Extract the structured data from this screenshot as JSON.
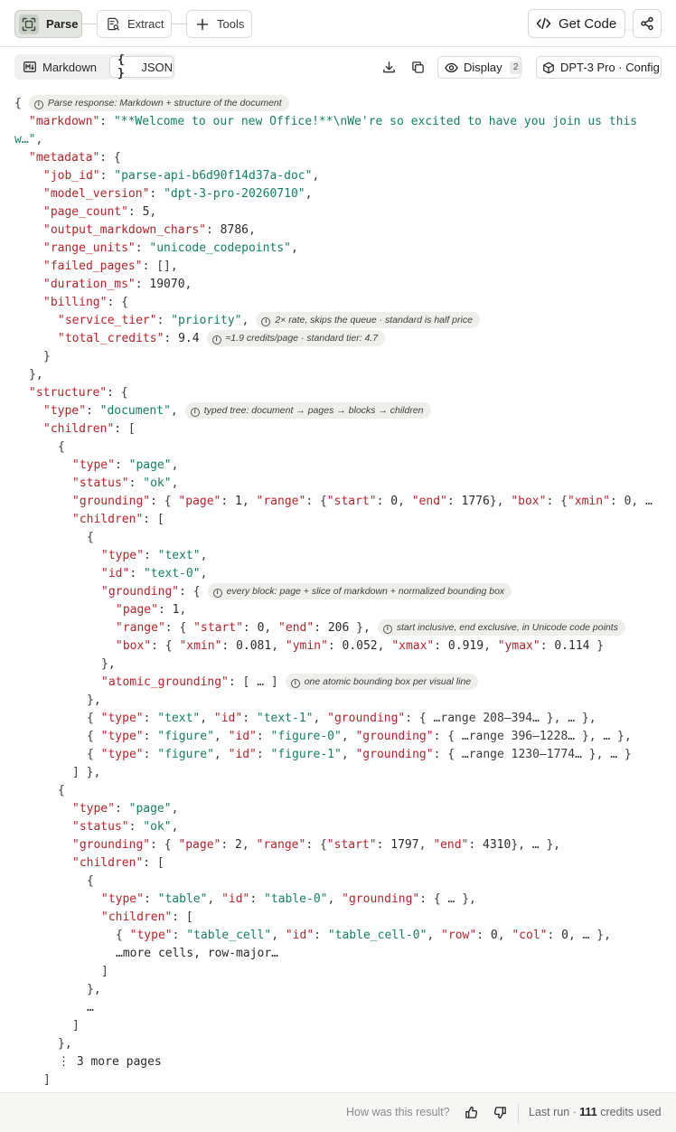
{
  "top_tabs": {
    "parse": "Parse",
    "extract": "Extract",
    "tools": "Tools"
  },
  "actions": {
    "get_code": "Get Code"
  },
  "format_tabs": {
    "markdown": "Markdown",
    "json": "JSON"
  },
  "display": {
    "label": "Display",
    "count": "2"
  },
  "config": {
    "label": "DPT-3 Pro · Config"
  },
  "json_view": {
    "lines": [
      {
        "indent": 0,
        "parts": [
          [
            "p",
            "{"
          ]
        ],
        "note": "Parse response: Markdown + structure of the document"
      },
      {
        "indent": 1,
        "parts": [
          [
            "k",
            "\"markdown\""
          ],
          [
            "p",
            ": "
          ],
          [
            "s",
            "\"**Welcome to our new Office!**\\nWe're so excited to have you join us this"
          ]
        ]
      },
      {
        "indent": 0,
        "parts": [
          [
            "s",
            "w…\""
          ],
          [
            "p",
            ","
          ]
        ]
      },
      {
        "indent": 1,
        "parts": [
          [
            "k",
            "\"metadata\""
          ],
          [
            "p",
            ": {"
          ]
        ]
      },
      {
        "indent": 2,
        "parts": [
          [
            "k",
            "\"job_id\""
          ],
          [
            "p",
            ": "
          ],
          [
            "s",
            "\"parse-api-b6d90f14d37a-doc\""
          ],
          [
            "p",
            ","
          ]
        ]
      },
      {
        "indent": 2,
        "parts": [
          [
            "k",
            "\"model_version\""
          ],
          [
            "p",
            ": "
          ],
          [
            "s",
            "\"dpt-3-pro-20260710\""
          ],
          [
            "p",
            ","
          ]
        ]
      },
      {
        "indent": 2,
        "parts": [
          [
            "k",
            "\"page_count\""
          ],
          [
            "p",
            ": "
          ],
          [
            "n",
            "5"
          ],
          [
            "p",
            ","
          ]
        ]
      },
      {
        "indent": 2,
        "parts": [
          [
            "k",
            "\"output_markdown_chars\""
          ],
          [
            "p",
            ": "
          ],
          [
            "n",
            "8786"
          ],
          [
            "p",
            ","
          ]
        ]
      },
      {
        "indent": 2,
        "parts": [
          [
            "k",
            "\"range_units\""
          ],
          [
            "p",
            ": "
          ],
          [
            "s",
            "\"unicode_codepoints\""
          ],
          [
            "p",
            ","
          ]
        ]
      },
      {
        "indent": 2,
        "parts": [
          [
            "k",
            "\"failed_pages\""
          ],
          [
            "p",
            ": [],"
          ]
        ]
      },
      {
        "indent": 2,
        "parts": [
          [
            "k",
            "\"duration_ms\""
          ],
          [
            "p",
            ": "
          ],
          [
            "n",
            "19070"
          ],
          [
            "p",
            ","
          ]
        ]
      },
      {
        "indent": 2,
        "parts": [
          [
            "k",
            "\"billing\""
          ],
          [
            "p",
            ": {"
          ]
        ]
      },
      {
        "indent": 3,
        "parts": [
          [
            "k",
            "\"service_tier\""
          ],
          [
            "p",
            ": "
          ],
          [
            "s",
            "\"priority\""
          ],
          [
            "p",
            ","
          ]
        ],
        "note": "2× rate, skips the queue · standard is half price"
      },
      {
        "indent": 3,
        "parts": [
          [
            "k",
            "\"total_credits\""
          ],
          [
            "p",
            ": "
          ],
          [
            "n",
            "9.4"
          ]
        ],
        "note": "≈1.9 credits/page · standard tier: 4.7"
      },
      {
        "indent": 2,
        "parts": [
          [
            "p",
            "}"
          ]
        ]
      },
      {
        "indent": 1,
        "parts": [
          [
            "p",
            "},"
          ]
        ]
      },
      {
        "indent": 1,
        "parts": [
          [
            "k",
            "\"structure\""
          ],
          [
            "p",
            ": {"
          ]
        ]
      },
      {
        "indent": 2,
        "parts": [
          [
            "k",
            "\"type\""
          ],
          [
            "p",
            ": "
          ],
          [
            "s",
            "\"document\""
          ],
          [
            "p",
            ","
          ]
        ],
        "note": "typed tree: document → pages → blocks → children"
      },
      {
        "indent": 2,
        "parts": [
          [
            "k",
            "\"children\""
          ],
          [
            "p",
            ": ["
          ]
        ]
      },
      {
        "indent": 3,
        "parts": [
          [
            "p",
            "{"
          ]
        ]
      },
      {
        "indent": 4,
        "parts": [
          [
            "k",
            "\"type\""
          ],
          [
            "p",
            ": "
          ],
          [
            "s",
            "\"page\""
          ],
          [
            "p",
            ","
          ]
        ]
      },
      {
        "indent": 4,
        "parts": [
          [
            "k",
            "\"status\""
          ],
          [
            "p",
            ": "
          ],
          [
            "s",
            "\"ok\""
          ],
          [
            "p",
            ","
          ]
        ]
      },
      {
        "indent": 4,
        "parts": [
          [
            "k",
            "\"grounding\""
          ],
          [
            "p",
            ": { "
          ],
          [
            "k",
            "\"page\""
          ],
          [
            "p",
            ": "
          ],
          [
            "n",
            "1"
          ],
          [
            "p",
            ", "
          ],
          [
            "k",
            "\"range\""
          ],
          [
            "p",
            ": {"
          ],
          [
            "k",
            "\"start\""
          ],
          [
            "p",
            ": "
          ],
          [
            "n",
            "0"
          ],
          [
            "p",
            ", "
          ],
          [
            "k",
            "\"end\""
          ],
          [
            "p",
            ": "
          ],
          [
            "n",
            "1776"
          ],
          [
            "p",
            "}, "
          ],
          [
            "k",
            "\"box\""
          ],
          [
            "p",
            ": {"
          ],
          [
            "k",
            "\"xmin\""
          ],
          [
            "p",
            ": 0, …"
          ]
        ]
      },
      {
        "indent": 4,
        "parts": [
          [
            "k",
            "\"children\""
          ],
          [
            "p",
            ": ["
          ]
        ]
      },
      {
        "indent": 5,
        "parts": [
          [
            "p",
            "{"
          ]
        ]
      },
      {
        "indent": 6,
        "parts": [
          [
            "k",
            "\"type\""
          ],
          [
            "p",
            ": "
          ],
          [
            "s",
            "\"text\""
          ],
          [
            "p",
            ","
          ]
        ]
      },
      {
        "indent": 6,
        "parts": [
          [
            "k",
            "\"id\""
          ],
          [
            "p",
            ": "
          ],
          [
            "s",
            "\"text-0\""
          ],
          [
            "p",
            ","
          ]
        ]
      },
      {
        "indent": 6,
        "parts": [
          [
            "k",
            "\"grounding\""
          ],
          [
            "p",
            ": {"
          ]
        ],
        "note": "every block: page + slice of markdown + normalized bounding box"
      },
      {
        "indent": 7,
        "parts": [
          [
            "k",
            "\"page\""
          ],
          [
            "p",
            ": "
          ],
          [
            "n",
            "1"
          ],
          [
            "p",
            ","
          ]
        ]
      },
      {
        "indent": 7,
        "parts": [
          [
            "k",
            "\"range\""
          ],
          [
            "p",
            ": { "
          ],
          [
            "k",
            "\"start\""
          ],
          [
            "p",
            ": "
          ],
          [
            "n",
            "0"
          ],
          [
            "p",
            ", "
          ],
          [
            "k",
            "\"end\""
          ],
          [
            "p",
            ": "
          ],
          [
            "n",
            "206"
          ],
          [
            "p",
            " },"
          ]
        ],
        "note": "start inclusive, end exclusive, in Unicode code points"
      },
      {
        "indent": 7,
        "parts": [
          [
            "k",
            "\"box\""
          ],
          [
            "p",
            ": { "
          ],
          [
            "k",
            "\"xmin\""
          ],
          [
            "p",
            ": "
          ],
          [
            "n",
            "0.081"
          ],
          [
            "p",
            ", "
          ],
          [
            "k",
            "\"ymin\""
          ],
          [
            "p",
            ": "
          ],
          [
            "n",
            "0.052"
          ],
          [
            "p",
            ", "
          ],
          [
            "k",
            "\"xmax\""
          ],
          [
            "p",
            ": "
          ],
          [
            "n",
            "0.919"
          ],
          [
            "p",
            ", "
          ],
          [
            "k",
            "\"ymax\""
          ],
          [
            "p",
            ": "
          ],
          [
            "n",
            "0.114"
          ],
          [
            "p",
            " }"
          ]
        ]
      },
      {
        "indent": 6,
        "parts": [
          [
            "p",
            "},"
          ]
        ]
      },
      {
        "indent": 6,
        "parts": [
          [
            "k",
            "\"atomic_grounding\""
          ],
          [
            "p",
            ": [ … ]"
          ]
        ],
        "note": "one atomic bounding box per visual line"
      },
      {
        "indent": 5,
        "parts": [
          [
            "p",
            "},"
          ]
        ]
      },
      {
        "indent": 5,
        "parts": [
          [
            "p",
            "{ "
          ],
          [
            "k",
            "\"type\""
          ],
          [
            "p",
            ": "
          ],
          [
            "s",
            "\"text\""
          ],
          [
            "p",
            ", "
          ],
          [
            "k",
            "\"id\""
          ],
          [
            "p",
            ": "
          ],
          [
            "s",
            "\"text-1\""
          ],
          [
            "p",
            ", "
          ],
          [
            "k",
            "\"grounding\""
          ],
          [
            "p",
            ": { …range 208–394… }, … },"
          ]
        ]
      },
      {
        "indent": 5,
        "parts": [
          [
            "p",
            "{ "
          ],
          [
            "k",
            "\"type\""
          ],
          [
            "p",
            ": "
          ],
          [
            "s",
            "\"figure\""
          ],
          [
            "p",
            ", "
          ],
          [
            "k",
            "\"id\""
          ],
          [
            "p",
            ": "
          ],
          [
            "s",
            "\"figure-0\""
          ],
          [
            "p",
            ", "
          ],
          [
            "k",
            "\"grounding\""
          ],
          [
            "p",
            ": { …range 396–1228… }, … },"
          ]
        ]
      },
      {
        "indent": 5,
        "parts": [
          [
            "p",
            "{ "
          ],
          [
            "k",
            "\"type\""
          ],
          [
            "p",
            ": "
          ],
          [
            "s",
            "\"figure\""
          ],
          [
            "p",
            ", "
          ],
          [
            "k",
            "\"id\""
          ],
          [
            "p",
            ": "
          ],
          [
            "s",
            "\"figure-1\""
          ],
          [
            "p",
            ", "
          ],
          [
            "k",
            "\"grounding\""
          ],
          [
            "p",
            ": { …range 1230–1774… }, … }"
          ]
        ]
      },
      {
        "indent": 4,
        "parts": [
          [
            "p",
            "] },"
          ]
        ]
      },
      {
        "indent": 3,
        "parts": [
          [
            "p",
            "{"
          ]
        ]
      },
      {
        "indent": 4,
        "parts": [
          [
            "k",
            "\"type\""
          ],
          [
            "p",
            ": "
          ],
          [
            "s",
            "\"page\""
          ],
          [
            "p",
            ","
          ]
        ]
      },
      {
        "indent": 4,
        "parts": [
          [
            "k",
            "\"status\""
          ],
          [
            "p",
            ": "
          ],
          [
            "s",
            "\"ok\""
          ],
          [
            "p",
            ","
          ]
        ]
      },
      {
        "indent": 4,
        "parts": [
          [
            "k",
            "\"grounding\""
          ],
          [
            "p",
            ": { "
          ],
          [
            "k",
            "\"page\""
          ],
          [
            "p",
            ": "
          ],
          [
            "n",
            "2"
          ],
          [
            "p",
            ", "
          ],
          [
            "k",
            "\"range\""
          ],
          [
            "p",
            ": {"
          ],
          [
            "k",
            "\"start\""
          ],
          [
            "p",
            ": "
          ],
          [
            "n",
            "1797"
          ],
          [
            "p",
            ", "
          ],
          [
            "k",
            "\"end\""
          ],
          [
            "p",
            ": "
          ],
          [
            "n",
            "4310"
          ],
          [
            "p",
            "}, … },"
          ]
        ]
      },
      {
        "indent": 4,
        "parts": [
          [
            "k",
            "\"children\""
          ],
          [
            "p",
            ": ["
          ]
        ]
      },
      {
        "indent": 5,
        "parts": [
          [
            "p",
            "{"
          ]
        ]
      },
      {
        "indent": 6,
        "parts": [
          [
            "k",
            "\"type\""
          ],
          [
            "p",
            ": "
          ],
          [
            "s",
            "\"table\""
          ],
          [
            "p",
            ", "
          ],
          [
            "k",
            "\"id\""
          ],
          [
            "p",
            ": "
          ],
          [
            "s",
            "\"table-0\""
          ],
          [
            "p",
            ", "
          ],
          [
            "k",
            "\"grounding\""
          ],
          [
            "p",
            ": { … },"
          ]
        ]
      },
      {
        "indent": 6,
        "parts": [
          [
            "k",
            "\"children\""
          ],
          [
            "p",
            ": ["
          ]
        ]
      },
      {
        "indent": 7,
        "parts": [
          [
            "p",
            "{ "
          ],
          [
            "k",
            "\"type\""
          ],
          [
            "p",
            ": "
          ],
          [
            "s",
            "\"table_cell\""
          ],
          [
            "p",
            ", "
          ],
          [
            "k",
            "\"id\""
          ],
          [
            "p",
            ": "
          ],
          [
            "s",
            "\"table_cell-0\""
          ],
          [
            "p",
            ", "
          ],
          [
            "k",
            "\"row\""
          ],
          [
            "p",
            ": "
          ],
          [
            "n",
            "0"
          ],
          [
            "p",
            ", "
          ],
          [
            "k",
            "\"col\""
          ],
          [
            "p",
            ": "
          ],
          [
            "n",
            "0"
          ],
          [
            "p",
            ", … },"
          ]
        ]
      },
      {
        "indent": 7,
        "parts": [
          [
            "n",
            "…more cells, row-major…"
          ]
        ]
      },
      {
        "indent": 6,
        "parts": [
          [
            "p",
            "]"
          ]
        ]
      },
      {
        "indent": 5,
        "parts": [
          [
            "p",
            "},"
          ]
        ]
      },
      {
        "indent": 5,
        "parts": [
          [
            "n",
            "…"
          ]
        ]
      },
      {
        "indent": 4,
        "parts": [
          [
            "p",
            "]"
          ]
        ]
      },
      {
        "indent": 3,
        "parts": [
          [
            "p",
            "},"
          ]
        ]
      },
      {
        "indent": 3,
        "parts": [
          [
            "n",
            "⋮ 3 more pages"
          ]
        ]
      },
      {
        "indent": 2,
        "parts": [
          [
            "p",
            "]"
          ]
        ]
      },
      {
        "indent": 1,
        "parts": [
          [
            "p",
            "}"
          ]
        ]
      }
    ]
  },
  "footer": {
    "question": "How was this result?",
    "last_run_prefix": "Last run · ",
    "credits": "111",
    "credits_suffix": " credits used"
  },
  "colors": {
    "key": "#b5232b",
    "string": "#14805e",
    "active_tab": "#e4e7e1"
  },
  "icons": [
    "scan-icon",
    "extract-icon",
    "plus-icon",
    "code-icon",
    "share-icon",
    "markdown-icon",
    "braces-icon",
    "download-icon",
    "copy-icon",
    "eye-icon",
    "cube-icon",
    "thumbs-up-icon",
    "thumbs-down-icon",
    "info-icon"
  ]
}
